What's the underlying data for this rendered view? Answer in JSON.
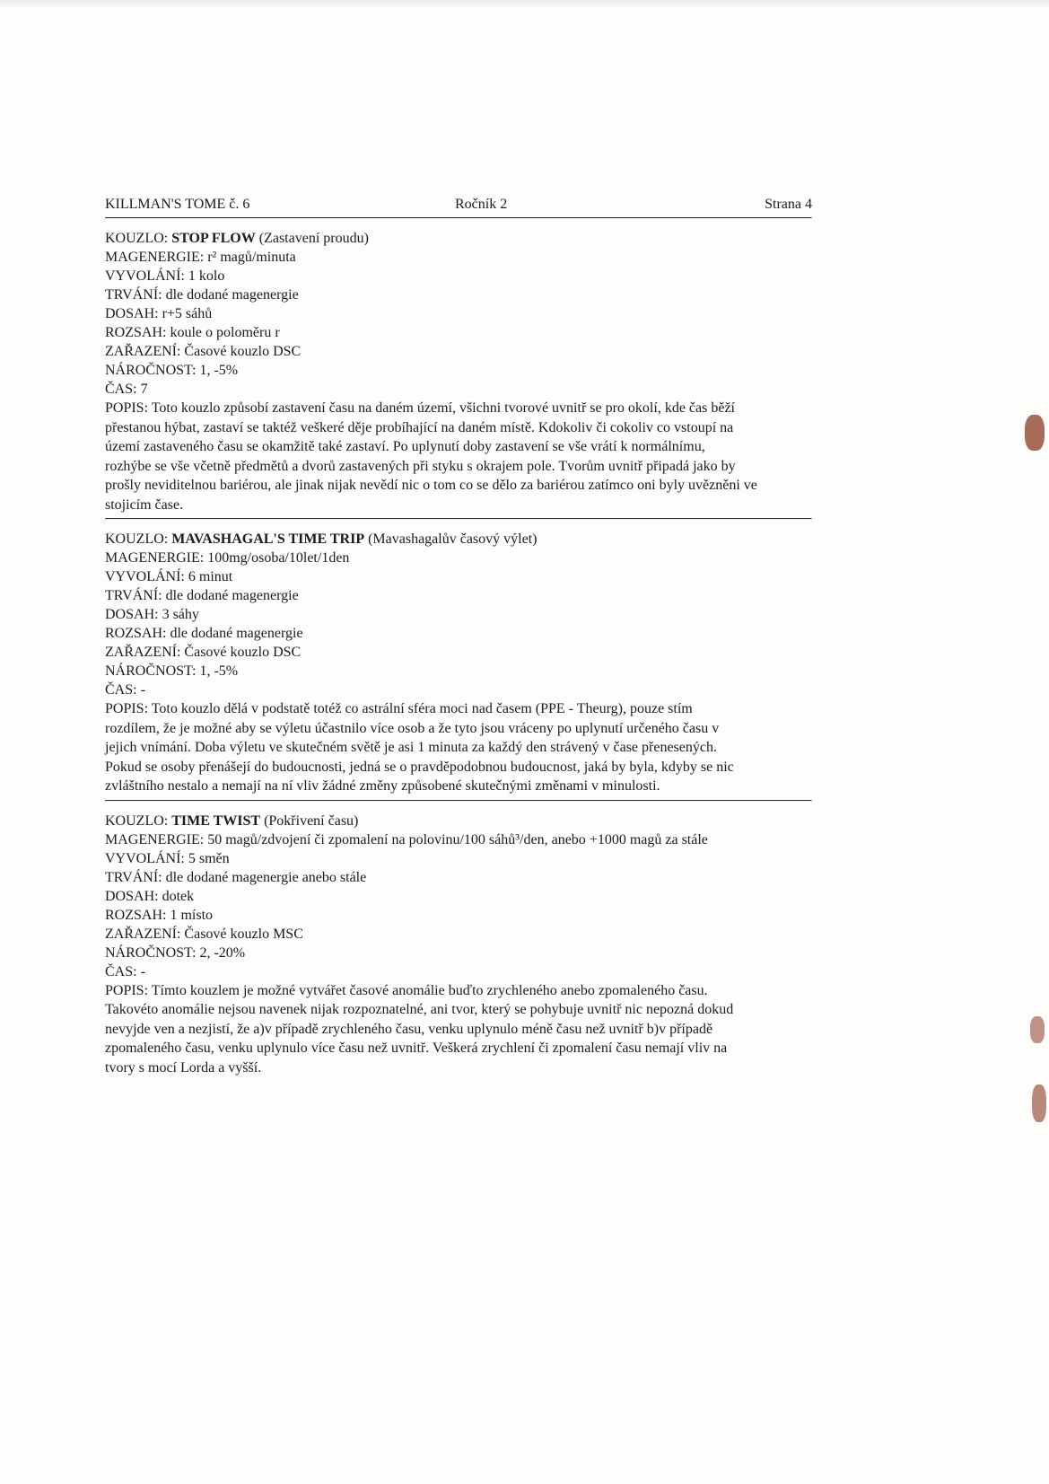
{
  "header": {
    "left": "KILLMAN'S TOME č. 6",
    "center": "Ročník 2",
    "right": "Strana 4"
  },
  "spells": [
    {
      "kouzlo_label": "KOUZLO:",
      "name": "STOP FLOW",
      "subtitle": "(Zastavení proudu)",
      "fields": [
        "MAGENERGIE: r² magů/minuta",
        "VYVOLÁNÍ: 1 kolo",
        "TRVÁNÍ: dle dodané magenergie",
        "DOSAH: r+5 sáhů",
        "ROZSAH: koule o poloměru r",
        "ZAŘAZENÍ: Časové kouzlo DSC",
        "NÁROČNOST: 1, -5%",
        "ČAS: 7"
      ],
      "popis": [
        "POPIS: Toto kouzlo způsobí zastavení času na daném území, všichni tvorové uvnitř se pro okolí, kde čas běží",
        "přestanou hýbat, zastaví se taktéž veškeré děje probíhající na daném místě. Kdokoliv či cokoliv co vstoupí na",
        "území zastaveného času se okamžitě také zastaví. Po uplynutí doby zastavení se vše vrátí k normálnímu,",
        "rozhýbe se vše včetně předmětů a dvorů zastavených při styku s okrajem pole. Tvorům uvnitř připadá jako by",
        "prošly neviditelnou bariérou, ale jinak nijak nevědí nic o tom co se dělo za bariérou zatímco oni byly uvězněni ve",
        "stojicím čase."
      ]
    },
    {
      "kouzlo_label": "KOUZLO:",
      "name": "MAVASHAGAL'S TIME TRIP",
      "subtitle": "(Mavashagalův časový výlet)",
      "fields": [
        "MAGENERGIE: 100mg/osoba/10let/1den",
        "VYVOLÁNÍ: 6 minut",
        "TRVÁNÍ: dle dodané magenergie",
        "DOSAH: 3 sáhy",
        "ROZSAH: dle dodané magenergie",
        "ZAŘAZENÍ: Časové kouzlo DSC",
        "NÁROČNOST: 1, -5%",
        "ČAS: -"
      ],
      "popis": [
        "POPIS: Toto kouzlo dělá v podstatě totéž co astrální sféra moci nad časem (PPE - Theurg), pouze stím",
        "rozdílem, že je možné aby se výletu účastnilo více osob a že tyto jsou vráceny po uplynutí určeného času v",
        "jejich vnímání. Doba výletu ve skutečném světě je asi 1 minuta za každý den strávený v čase přenesených.",
        "Pokud se osoby přenášejí do budoucnosti, jedná se o pravděpodobnou budoucnost, jaká by byla, kdyby se nic",
        "zvláštního nestalo a nemají na ní vliv žádné změny způsobené skutečnými změnami v minulosti."
      ]
    },
    {
      "kouzlo_label": "KOUZLO:",
      "name": "TIME TWIST",
      "subtitle": "(Pokřivení času)",
      "fields": [
        "MAGENERGIE: 50 magů/zdvojení či zpomalení na polovinu/100 sáhů³/den, anebo +1000 magů za stále",
        "VYVOLÁNÍ: 5 směn",
        "TRVÁNÍ: dle dodané magenergie anebo stále",
        "DOSAH: dotek",
        "ROZSAH: 1 místo",
        "ZAŘAZENÍ: Časové kouzlo MSC",
        "NÁROČNOST: 2, -20%",
        "ČAS: -"
      ],
      "popis": [
        "POPIS: Tímto kouzlem je možné vytvářet časové anomálie buďto zrychleného anebo zpomaleného času.",
        "Takovéto anomálie nejsou navenek nijak rozpoznatelné, ani tvor, který se pohybuje uvnitř nic nepozná dokud",
        "nevyjde ven a nezjistí, že a)v případě zrychleného času, venku uplynulo méně času než uvnitř b)v případě",
        "zpomaleného času, venku uplynulo více času než uvnitř. Veškerá zrychlení či zpomalení času nemají vliv na",
        "tvory s mocí Lorda a vyšší."
      ]
    }
  ],
  "colors": {
    "paper": "#fdfdfc",
    "ink": "#1c1c1c",
    "edge_stain": "#8a3b22"
  }
}
